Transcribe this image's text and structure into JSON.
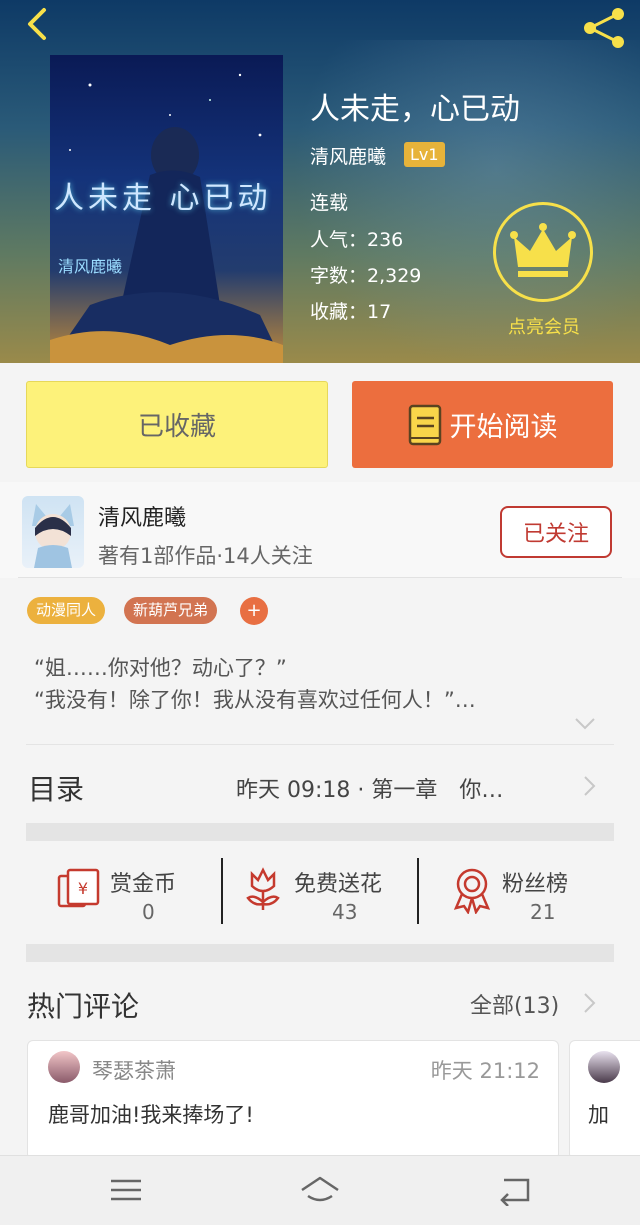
{
  "header": {
    "book_title": "人未走，心已动",
    "author": "清风鹿曦",
    "level": "Lv1",
    "status": "连载",
    "popularity": "人气：236",
    "word_count": "字数：2,329",
    "favorites": "收藏：17",
    "vip_label": "点亮会员"
  },
  "cover": {
    "title_text": "人未走 心已动",
    "author_text": "清风鹿曦"
  },
  "actions": {
    "favorited_label": "已收藏",
    "start_reading_label": "开始阅读"
  },
  "author_row": {
    "name": "清风鹿曦",
    "meta": "著有1部作品·14人关注",
    "follow_label": "已关注"
  },
  "tags": [
    "动漫同人",
    "新葫芦兄弟"
  ],
  "add_tag": "+",
  "summary": {
    "line1": "“姐……你对他？动心了？”",
    "line2": "“我没有！除了你！我从没有喜欢过任何人！”…"
  },
  "catalog": {
    "label": "目录",
    "latest": "昨天 09:18 · 第一章　你…"
  },
  "stats": [
    {
      "name": "赏金币",
      "value": "0",
      "icon": "envelope-yen-icon"
    },
    {
      "name": "免费送花",
      "value": "43",
      "icon": "flower-icon"
    },
    {
      "name": "粉丝榜",
      "value": "21",
      "icon": "rosette-icon"
    }
  ],
  "comments": {
    "title": "热门评论",
    "all_label": "全部(13)",
    "items": [
      {
        "user": "琴瑟茶萧",
        "time": "昨天 21:12",
        "text": "鹿哥加油!我来捧场了!"
      },
      {
        "text": "加"
      }
    ]
  },
  "colors": {
    "accent_orange": "#ec6e3e",
    "favorite_yellow": "#fdf27a",
    "vip_gold": "#f7e04a",
    "follow_red": "#c03a32"
  }
}
